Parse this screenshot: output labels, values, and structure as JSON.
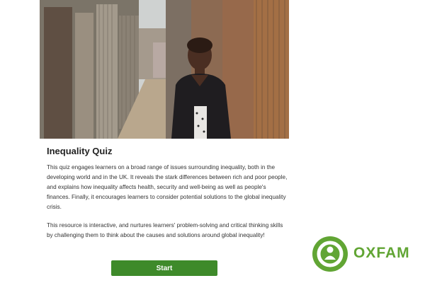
{
  "quiz": {
    "title": "Inequality Quiz",
    "paragraph_1": "This quiz engages learners on a broad range of issues surrounding inequality, both in the developing world and in the UK. It reveals the stark differences between rich and poor people, and explains how inequality affects health, security and well-being as well as people's finances. Finally, it encourages learners to consider potential solutions to the global inequality crisis.",
    "paragraph_2": "This resource is interactive, and nurtures learners' problem-solving and critical thinking skills by challenging them to think about the causes and solutions around global inequality!",
    "start_label": "Start"
  },
  "logo": {
    "wordmark": "OXFAM",
    "icon": "oxfam-person-icon",
    "color": "#61a534"
  },
  "hero": {
    "icon": "hero-photo"
  },
  "colors": {
    "button": "#3e8a2a",
    "text": "#333333"
  }
}
